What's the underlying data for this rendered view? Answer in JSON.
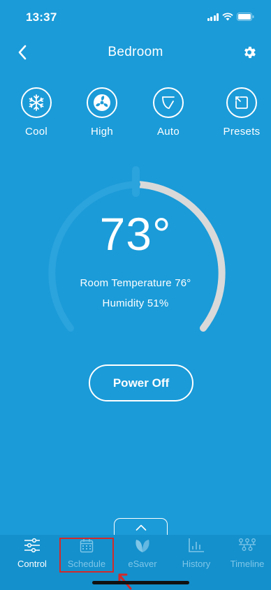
{
  "status_bar": {
    "time": "13:37"
  },
  "header": {
    "title": "Bedroom"
  },
  "modes": [
    {
      "label": "Cool",
      "icon": "snowflake-icon"
    },
    {
      "label": "High",
      "icon": "fan-icon"
    },
    {
      "label": "Auto",
      "icon": "auto-mode-icon"
    },
    {
      "label": "Presets",
      "icon": "presets-icon"
    }
  ],
  "thermostat": {
    "set_temperature": "73°",
    "room_temperature": "Room Temperature 76°",
    "humidity": "Humidity 51%",
    "colors": {
      "active_arc": "#2ba3dd",
      "inactive_arc": "#d8d8d8",
      "accent": "#1b9bd8"
    }
  },
  "power_button": {
    "label": "Power Off"
  },
  "tab_bar": {
    "tabs": [
      {
        "label": "Control",
        "icon": "sliders-icon",
        "active": true
      },
      {
        "label": "Schedule",
        "icon": "calendar-icon",
        "active": false
      },
      {
        "label": "eSaver",
        "icon": "leaf-icon",
        "active": false
      },
      {
        "label": "History",
        "icon": "bar-chart-icon",
        "active": false
      },
      {
        "label": "Timeline",
        "icon": "timeline-icon",
        "active": false
      }
    ]
  }
}
